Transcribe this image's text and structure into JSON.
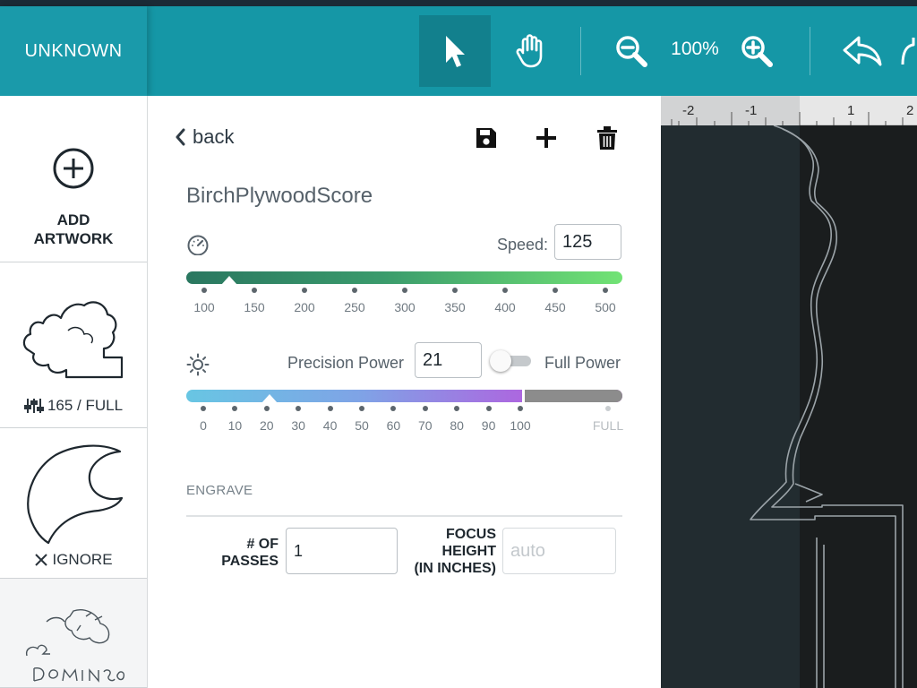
{
  "topbar": {
    "brand": "UNKNOWN",
    "tools": {
      "select": "cursor-arrow-icon",
      "pan": "hand-icon",
      "zoom_out": "zoom-out-icon",
      "zoom_in": "zoom-in-icon",
      "undo": "undo-icon",
      "redo": "redo-icon"
    },
    "zoom_level": "100%"
  },
  "artwork_list": {
    "add_label_line1": "ADD",
    "add_label_line2": "ARTWORK",
    "items": [
      {
        "status_icon": "sliders-icon",
        "status": "165 / FULL"
      },
      {
        "status_icon": "close-icon",
        "status": "IGNORE"
      },
      {
        "status_icon": "",
        "status": ""
      }
    ]
  },
  "settings": {
    "back_label": "back",
    "actions": {
      "save": "save-icon",
      "add": "plus-icon",
      "delete": "trash-icon"
    },
    "preset_name": "BirchPlywoodScore",
    "speed": {
      "label": "Speed:",
      "value": "125",
      "ticks": [
        "100",
        "150",
        "200",
        "250",
        "300",
        "350",
        "400",
        "450",
        "500"
      ],
      "min": 100,
      "max": 500,
      "current": 125
    },
    "power": {
      "precision_label": "Precision Power",
      "value": "21",
      "full_power_label": "Full Power",
      "full_power_enabled": false,
      "ticks": [
        "0",
        "10",
        "20",
        "30",
        "40",
        "50",
        "60",
        "70",
        "80",
        "90",
        "100"
      ],
      "full_tick": "FULL",
      "current": 21
    },
    "engrave": {
      "section_label": "ENGRAVE",
      "passes_label_line1": "# OF",
      "passes_label_line2": "PASSES",
      "passes_value": "1",
      "focus_label_line1": "FOCUS",
      "focus_label_line2": "HEIGHT",
      "focus_label_line3": "(IN INCHES)",
      "focus_placeholder": "auto"
    }
  },
  "canvas": {
    "ruler_labels": [
      "-2",
      "-1",
      "1",
      "2"
    ],
    "colors": {
      "background": "#222c30",
      "bed": "#1a1d1e",
      "outline": "#9ba3a8"
    }
  }
}
